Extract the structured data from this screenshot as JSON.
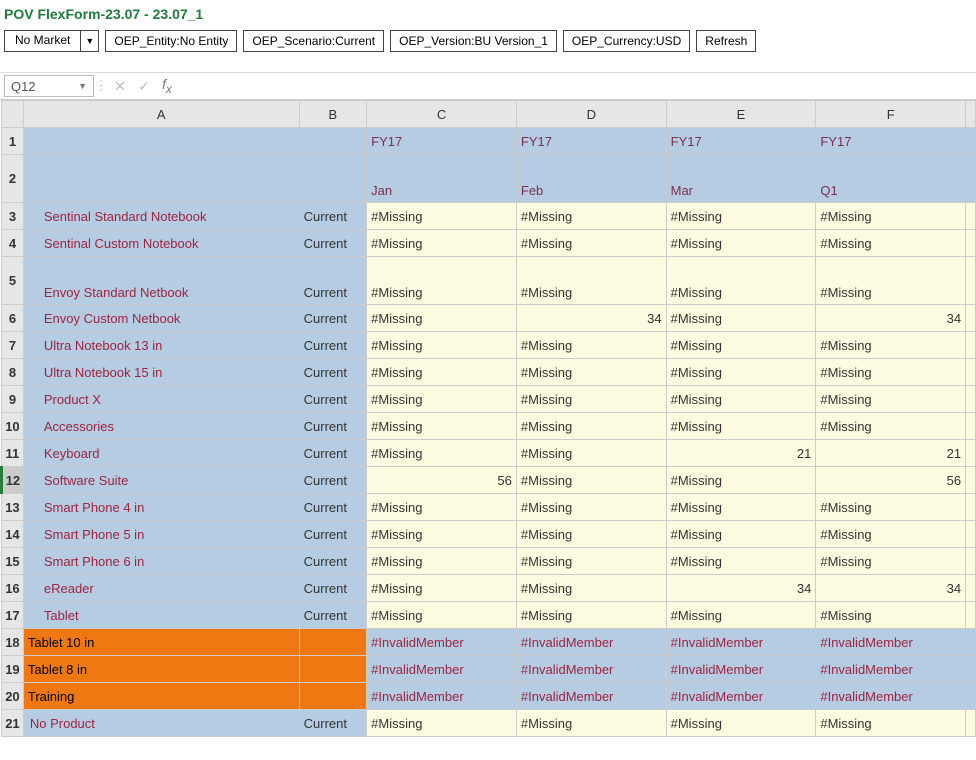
{
  "title": "POV FlexForm-23.07 - 23.07_1",
  "pov": {
    "market": "No Market",
    "entity": "OEP_Entity:No Entity",
    "scenario": "OEP_Scenario:Current",
    "version": "OEP_Version:BU Version_1",
    "currency": "OEP_Currency:USD",
    "refresh": "Refresh"
  },
  "namebox": "Q12",
  "colHeaders": [
    "A",
    "B",
    "C",
    "D",
    "E",
    "F"
  ],
  "row1": {
    "fy_c": "FY17",
    "fy_d": "FY17",
    "fy_e": "FY17",
    "fy_f": "FY17"
  },
  "row2": {
    "q1": "Q1",
    "c": "Jan",
    "d": "Feb",
    "e": "Mar",
    "f": ""
  },
  "missing": "#Missing",
  "invalid": "#InvalidMember",
  "rows": [
    {
      "n": "3",
      "name": "Sentinal Standard Notebook",
      "b": "Current",
      "c": "#Missing",
      "d": "#Missing",
      "e": "#Missing",
      "f": "#Missing",
      "t": "m"
    },
    {
      "n": "4",
      "name": "Sentinal Custom Notebook",
      "b": "Current",
      "c": "#Missing",
      "d": "#Missing",
      "e": "#Missing",
      "f": "#Missing",
      "t": "m"
    },
    {
      "n": "5",
      "name": "Envoy Standard Netbook",
      "b": "Current",
      "c": "#Missing",
      "d": "#Missing",
      "e": "#Missing",
      "f": "#Missing",
      "t": "m"
    },
    {
      "n": "6",
      "name": "Envoy Custom Netbook",
      "b": "Current",
      "c": "#Missing",
      "d": "34",
      "e": "#Missing",
      "f": "34",
      "t": "m",
      "dn": true,
      "fn": true
    },
    {
      "n": "7",
      "name": "Ultra Notebook 13 in",
      "b": "Current",
      "c": "#Missing",
      "d": "#Missing",
      "e": "#Missing",
      "f": "#Missing",
      "t": "m"
    },
    {
      "n": "8",
      "name": "Ultra Notebook 15 in",
      "b": "Current",
      "c": "#Missing",
      "d": "#Missing",
      "e": "#Missing",
      "f": "#Missing",
      "t": "m"
    },
    {
      "n": "9",
      "name": "Product X",
      "b": "Current",
      "c": "#Missing",
      "d": "#Missing",
      "e": "#Missing",
      "f": "#Missing",
      "t": "m"
    },
    {
      "n": "10",
      "name": "Accessories",
      "b": "Current",
      "c": "#Missing",
      "d": "#Missing",
      "e": "#Missing",
      "f": "#Missing",
      "t": "m"
    },
    {
      "n": "11",
      "name": "Keyboard",
      "b": "Current",
      "c": "#Missing",
      "d": "#Missing",
      "e": "21",
      "f": "21",
      "t": "m",
      "en": true,
      "fn": true
    },
    {
      "n": "12",
      "name": "Software Suite",
      "b": "Current",
      "c": "56",
      "d": "#Missing",
      "e": "#Missing",
      "f": "56",
      "t": "m",
      "cn": true,
      "fn": true,
      "sel": true
    },
    {
      "n": "13",
      "name": "Smart Phone 4 in",
      "b": "Current",
      "c": "#Missing",
      "d": "#Missing",
      "e": "#Missing",
      "f": "#Missing",
      "t": "m"
    },
    {
      "n": "14",
      "name": "Smart Phone 5 in",
      "b": "Current",
      "c": "#Missing",
      "d": "#Missing",
      "e": "#Missing",
      "f": "#Missing",
      "t": "m"
    },
    {
      "n": "15",
      "name": "Smart Phone 6 in",
      "b": "Current",
      "c": "#Missing",
      "d": "#Missing",
      "e": "#Missing",
      "f": "#Missing",
      "t": "m"
    },
    {
      "n": "16",
      "name": "eReader",
      "b": "Current",
      "c": "#Missing",
      "d": "#Missing",
      "e": "34",
      "f": "34",
      "t": "m",
      "en": true,
      "fn": true
    },
    {
      "n": "17",
      "name": "Tablet",
      "b": "Current",
      "c": "#Missing",
      "d": "#Missing",
      "e": "#Missing",
      "f": "#Missing",
      "t": "m"
    },
    {
      "n": "18",
      "name": "Tablet 10 in",
      "b": "",
      "c": "#InvalidMember",
      "d": "#InvalidMember",
      "e": "#InvalidMember",
      "f": "#InvalidMember",
      "t": "inv"
    },
    {
      "n": "19",
      "name": "Tablet 8 in",
      "b": "",
      "c": "#InvalidMember",
      "d": "#InvalidMember",
      "e": "#InvalidMember",
      "f": "#InvalidMember",
      "t": "inv"
    },
    {
      "n": "20",
      "name": "Training",
      "b": "",
      "c": "#InvalidMember",
      "d": "#InvalidMember",
      "e": "#InvalidMember",
      "f": "#InvalidMember",
      "t": "inv"
    },
    {
      "n": "21",
      "name": "No Product",
      "b": "Current",
      "c": "#Missing",
      "d": "#Missing",
      "e": "#Missing",
      "f": "#Missing",
      "t": "np"
    }
  ]
}
